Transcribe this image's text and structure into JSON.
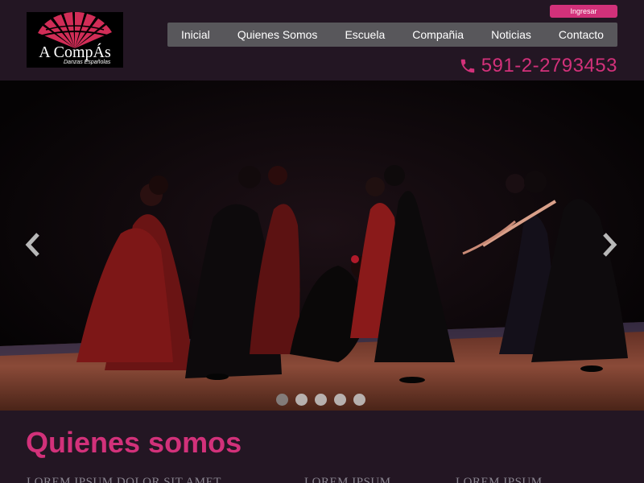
{
  "brand": {
    "logo_title": "A CompÁs",
    "logo_subtitle": "Danzas Españolas"
  },
  "header": {
    "login_label": "Ingresar",
    "phone": "591-2-2793453"
  },
  "nav": {
    "items": [
      "Inicial",
      "Quienes Somos",
      "Escuela",
      "Compañia",
      "Noticias",
      "Contacto"
    ]
  },
  "slider": {
    "prev_icon": "chevron-left-icon",
    "next_icon": "chevron-right-icon",
    "dot_count": 5,
    "active_dot": 1
  },
  "about": {
    "title": "Quienes somos",
    "columns": [
      "LOREM IPSUM DOLOR SIT AMET",
      "LOREM IPSUM",
      "LOREM IPSUM"
    ]
  },
  "colors": {
    "accent": "#d2317a",
    "background": "#231623",
    "nav_bg": "#58575b"
  }
}
